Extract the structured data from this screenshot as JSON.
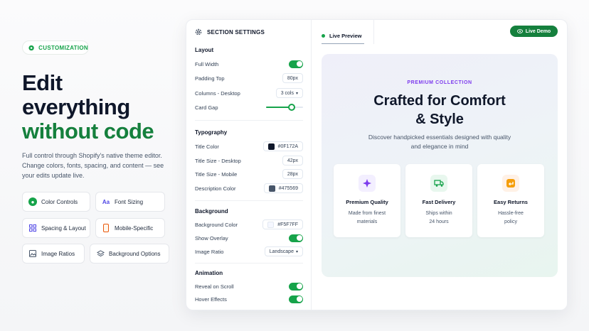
{
  "hero": {
    "badge": "CUSTOMIZATION",
    "headline_1": "Edit",
    "headline_2": "everything",
    "headline_3": "without code",
    "description": "Full control through Shopify's native theme editor. Change colors, fonts, spacing, and content — see your edits update live."
  },
  "features": [
    {
      "label": "Color Controls",
      "icon": "palette-icon"
    },
    {
      "label": "Font Sizing",
      "icon": "font-icon"
    },
    {
      "label": "Spacing & Layout",
      "icon": "grid-icon"
    },
    {
      "label": "Mobile-Specific",
      "icon": "mobile-icon"
    },
    {
      "label": "Image Ratios",
      "icon": "image-icon"
    },
    {
      "label": "Background Options",
      "icon": "layers-icon"
    }
  ],
  "settings": {
    "title": "SECTION SETTINGS",
    "layout": {
      "heading": "Layout",
      "full_width": "Full Width",
      "padding_top": "Padding Top",
      "padding_top_value": "80px",
      "columns": "Columns - Desktop",
      "columns_value": "3 cols",
      "card_gap": "Card Gap",
      "card_gap_level": 0.7
    },
    "typography": {
      "heading": "Typography",
      "title_color": "Title Color",
      "title_color_value": "#0F172A",
      "title_size_desktop": "Title Size - Desktop",
      "title_size_desktop_value": "42px",
      "title_size_mobile": "Title Size - Mobile",
      "title_size_mobile_value": "28px",
      "description_color": "Description Color",
      "description_color_value": "#475569"
    },
    "background": {
      "heading": "Background",
      "background_color": "Background Color",
      "background_color_value": "#F5F7FF",
      "show_overlay": "Show Overlay",
      "image_ratio": "Image Ratio",
      "image_ratio_value": "Landscape"
    },
    "animation": {
      "heading": "Animation",
      "reveal": "Reveal on Scroll",
      "hover": "Hover Effects"
    }
  },
  "preview": {
    "tab": "Live Preview",
    "demo_button": "Live Demo",
    "eyebrow": "PREMIUM COLLECTION",
    "title_1": "Crafted for Comfort",
    "title_2": "& Style",
    "desc_1": "Discover handpicked essentials designed with quality",
    "desc_2": "and elegance in mind",
    "cards": [
      {
        "title": "Premium Quality",
        "desc_1": "Made from finest",
        "desc_2": "materials",
        "icon": "sparkle-icon",
        "color": "#7c3aed"
      },
      {
        "title": "Fast Delivery",
        "desc_1": "Ships within",
        "desc_2": "24 hours",
        "icon": "truck-icon",
        "color": "#16a34a"
      },
      {
        "title": "Easy Returns",
        "desc_1": "Hassle-free",
        "desc_2": "policy",
        "icon": "return-icon",
        "color": "#ea580c"
      }
    ]
  }
}
